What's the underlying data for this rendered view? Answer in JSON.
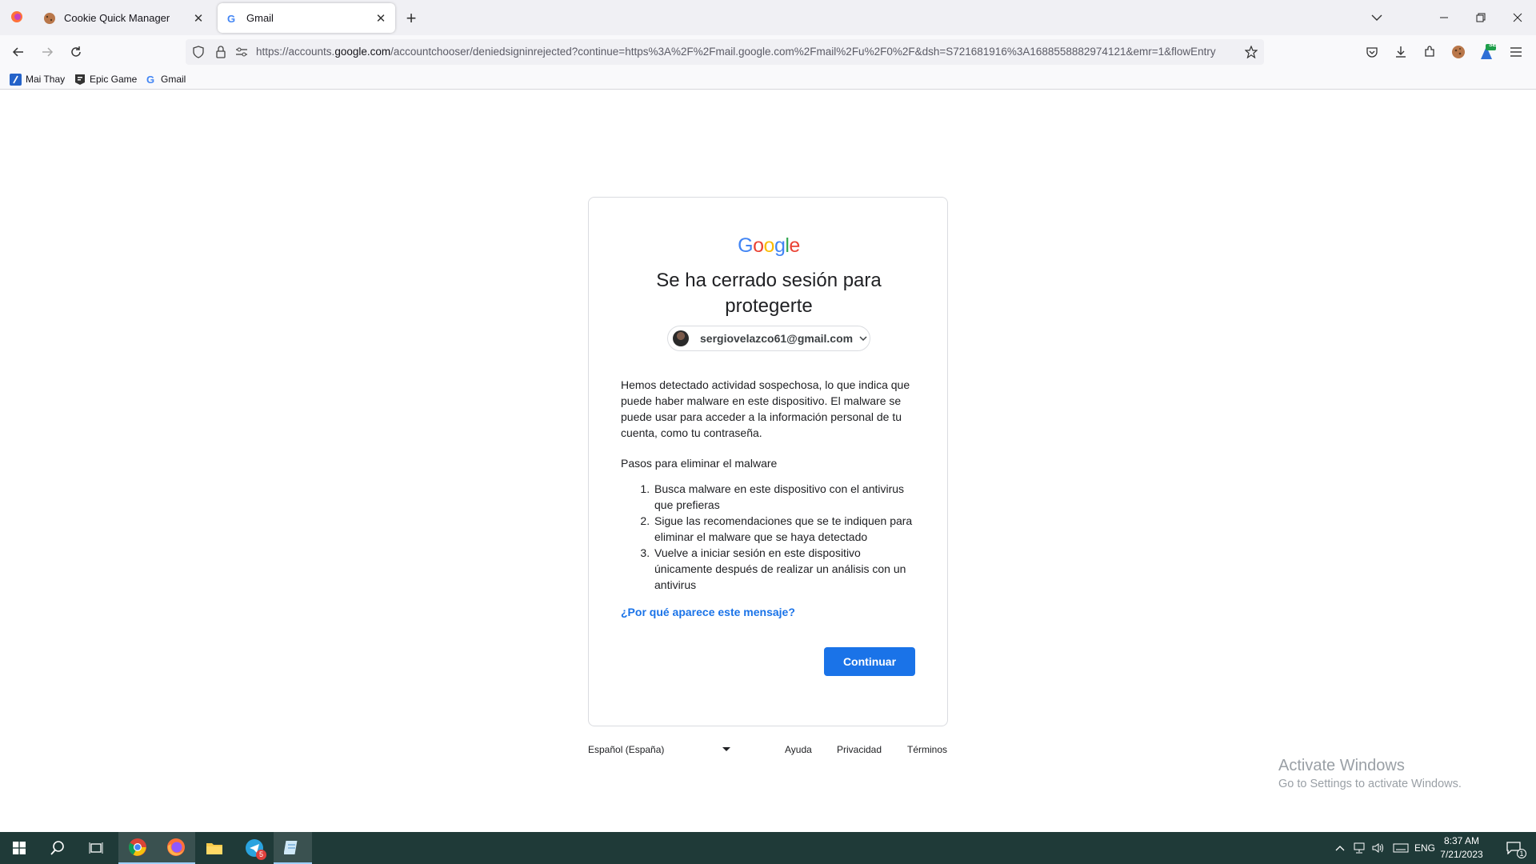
{
  "browser": {
    "tabs": [
      {
        "title": "Cookie Quick Manager",
        "favicon": "cookie-icon"
      },
      {
        "title": "Gmail",
        "favicon": "google-g-icon"
      }
    ],
    "url": {
      "prefix": "https://accounts.",
      "host": "google.com",
      "path": "/accountchooser/deniedsigninrejected?continue=https%3A%2F%2Fmail.google.com%2Fmail%2Fu%2F0%2F&dsh=S721681916%3A1688558882974121&emr=1&flowEntry"
    },
    "bookmarks": [
      {
        "label": "Mai Thay",
        "icon": "bookmark-slash-icon"
      },
      {
        "label": "Epic Game",
        "icon": "epic-games-icon"
      },
      {
        "label": "Gmail",
        "icon": "google-g-icon"
      }
    ],
    "extension_badge": "SE"
  },
  "page": {
    "logo": "Google",
    "heading": "Se ha cerrado sesión para protegerte",
    "account_email": "sergiovelazco61@gmail.com",
    "paragraph": "Hemos detectado actividad sospechosa, lo que indica que puede haber malware en este dispositivo. El malware se puede usar para acceder a la información personal de tu cuenta, como tu contraseña.",
    "steps_title": "Pasos para eliminar el malware",
    "steps": [
      "Busca malware en este dispositivo con el antivirus que prefieras",
      "Sigue las recomendaciones que se te indiquen para eliminar el malware que se haya detectado",
      "Vuelve a iniciar sesión en este dispositivo únicamente después de realizar un análisis con un antivirus"
    ],
    "why_link": "¿Por qué aparece este mensaje?",
    "continue_label": "Continuar"
  },
  "footer": {
    "language": "Español (España)",
    "links": [
      "Ayuda",
      "Privacidad",
      "Términos"
    ]
  },
  "watermark": {
    "line1": "Activate Windows",
    "line2": "Go to Settings to activate Windows."
  },
  "taskbar": {
    "telegram_badge": "5",
    "language": "ENG",
    "time": "8:37 AM",
    "date": "7/21/2023",
    "notification_count": "1"
  },
  "colors": {
    "accent": "#1a73e8",
    "taskbar": "#1f3a38"
  }
}
